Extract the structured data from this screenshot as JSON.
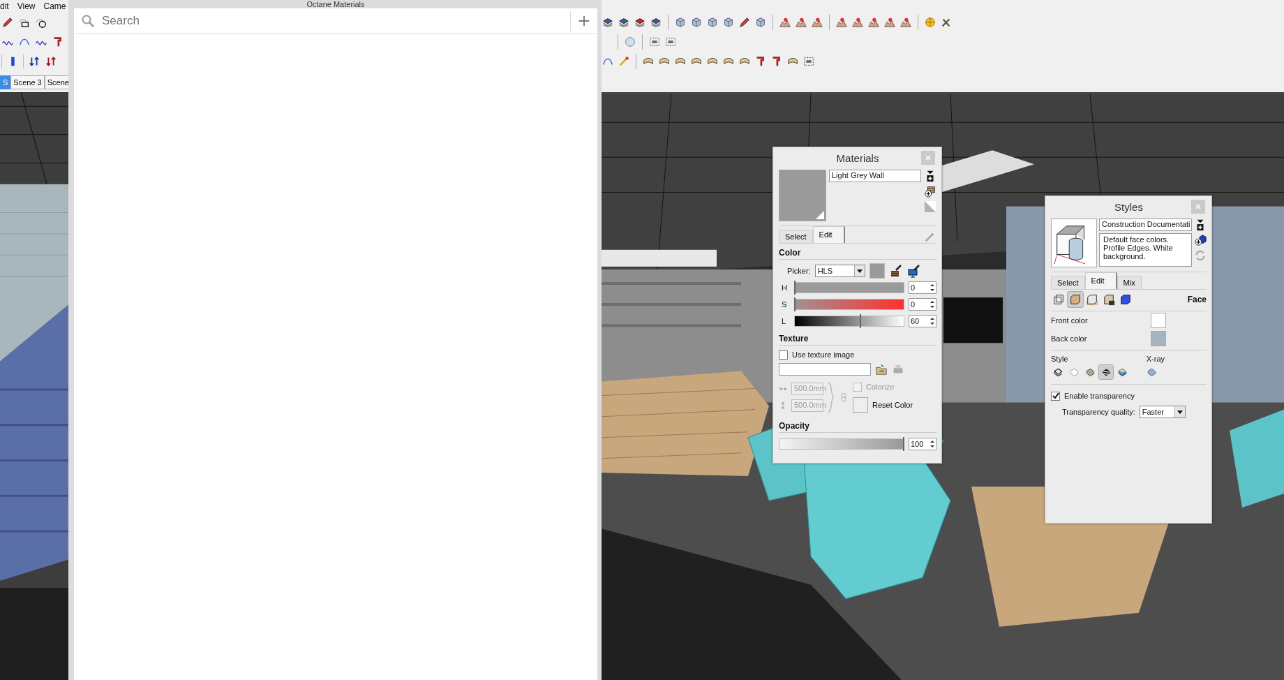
{
  "main_menu": [
    "dit",
    "View",
    "Came"
  ],
  "scene_tabs": [
    {
      "label": "S",
      "selected": true
    },
    {
      "label": "Scene 3",
      "selected": false
    },
    {
      "label": "Scene",
      "selected": false
    }
  ],
  "octane_materials": {
    "title": "Octane Materials",
    "search": {
      "placeholder": "Search"
    }
  },
  "materials": {
    "title": "Materials",
    "material_name": "Light Grey Wall",
    "tabs": [
      {
        "label": "Select",
        "selected": false
      },
      {
        "label": "Edit",
        "selected": true
      }
    ],
    "color_heading": "Color",
    "picker_label": "Picker:",
    "picker_value": "HLS",
    "channels": [
      {
        "kind": "hue",
        "label": "H",
        "value": "0",
        "level": 0
      },
      {
        "kind": "saturation",
        "label": "S",
        "value": "0",
        "level": 0
      },
      {
        "kind": "lightness",
        "label": "L",
        "value": "60",
        "level": 0.6
      }
    ],
    "texture_heading": "Texture",
    "use_texture": {
      "label": "Use texture image",
      "checked": false
    },
    "tile_width": {
      "value": "500.0mm",
      "disabled": true
    },
    "tile_height": {
      "value": "500.0mm",
      "disabled": true
    },
    "colorize": {
      "label": "Colorize",
      "checked": false,
      "disabled": true
    },
    "reset_color": "Reset Color",
    "opacity_heading": "Opacity",
    "opacity": {
      "value": "100",
      "level": 1
    }
  },
  "styles": {
    "title": "Styles",
    "style_name": "Construction Documentati",
    "description": "Default face colors. Profile Edges. White background.",
    "tabs": [
      {
        "label": "Select",
        "selected": false
      },
      {
        "label": "Edit",
        "selected": true
      },
      {
        "label": "Mix",
        "selected": false
      }
    ],
    "categories": [
      {
        "selected": false
      },
      {
        "selected": true
      },
      {
        "selected": false
      },
      {
        "selected": false
      },
      {
        "selected": false
      }
    ],
    "section_title": "Face",
    "front_color_label": "Front color",
    "back_color_label": "Back color",
    "style_label": "Style",
    "xray_label": "X-ray",
    "face_styles": [
      {
        "selected": false
      },
      {
        "selected": false
      },
      {
        "selected": false
      },
      {
        "selected": true
      },
      {
        "selected": false
      }
    ],
    "enable_transparency": {
      "label": "Enable transparency",
      "checked": true
    },
    "quality_label": "Transparency quality:",
    "quality_value": "Faster"
  }
}
